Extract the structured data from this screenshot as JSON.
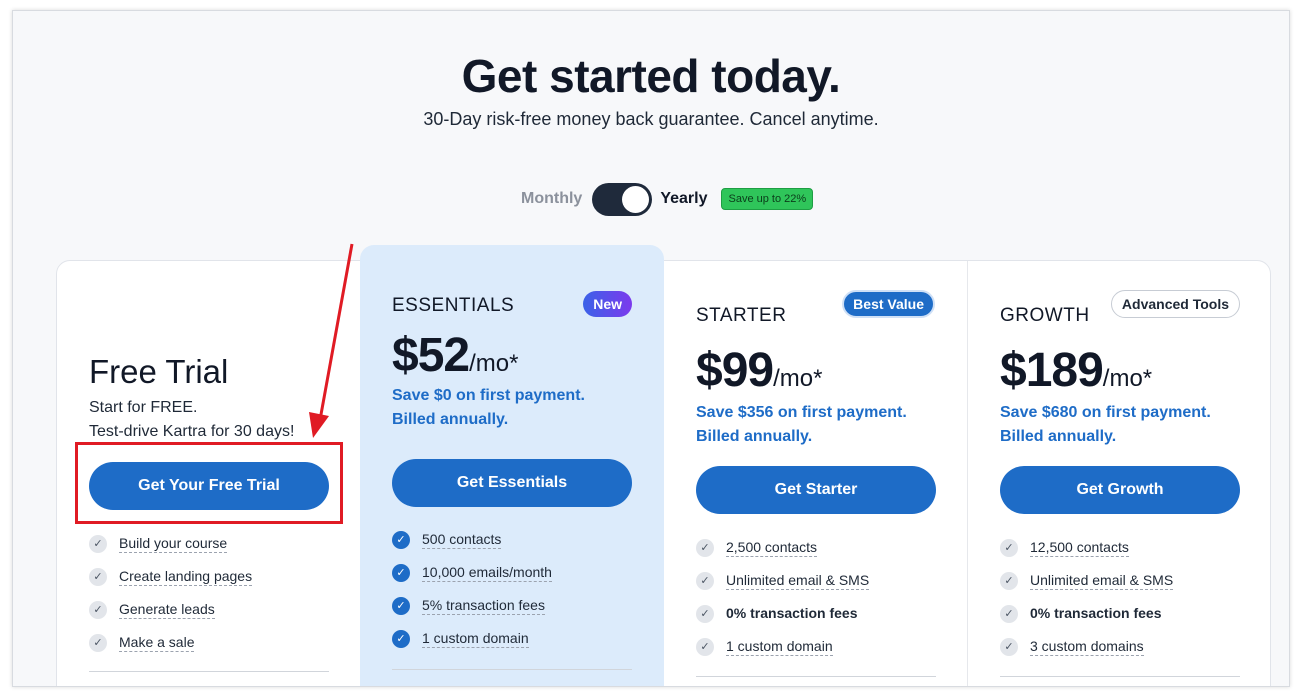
{
  "header": {
    "title": "Get started today.",
    "subtitle": "30-Day risk-free money back guarantee. Cancel anytime."
  },
  "billing_toggle": {
    "monthly_label": "Monthly",
    "yearly_label": "Yearly",
    "selected": "Yearly",
    "save_badge": "Save up to 22%"
  },
  "plans": [
    {
      "title": "Free Trial",
      "subtitle_line1": "Start for FREE.",
      "subtitle_line2": "Test-drive Kartra for 30 days!",
      "cta": "Get Your Free Trial",
      "features": [
        "Build your course",
        "Create landing pages",
        "Generate leads",
        "Make a sale"
      ]
    },
    {
      "name": "ESSENTIALS",
      "badge": "New",
      "price": "$52",
      "per": "/mo*",
      "savings_line1": "Save $0 on first payment.",
      "savings_line2": "Billed annually.",
      "cta": "Get Essentials",
      "features": [
        "500 contacts",
        "10,000 emails/month",
        "5% transaction fees",
        "1 custom domain"
      ]
    },
    {
      "name": "STARTER",
      "badge": "Best Value",
      "price": "$99",
      "per": "/mo*",
      "savings_line1": "Save $356 on first payment.",
      "savings_line2": "Billed annually.",
      "cta": "Get Starter",
      "features": [
        "2,500 contacts",
        "Unlimited email & SMS",
        "0% transaction fees",
        "1 custom domain"
      ]
    },
    {
      "name": "GROWTH",
      "badge": "Advanced Tools",
      "price": "$189",
      "per": "/mo*",
      "savings_line1": "Save $680 on first payment.",
      "savings_line2": "Billed annually.",
      "cta": "Get Growth",
      "features": [
        "12,500 contacts",
        "Unlimited email & SMS",
        "0% transaction fees",
        "3 custom domains"
      ]
    }
  ],
  "colors": {
    "accent": "#1e6cc7",
    "highlight_box": "#e01b24",
    "featured_card_bg": "#dcebfb",
    "save_badge": "#2fc55a"
  },
  "icons": [
    "check-icon",
    "annotation-arrow"
  ]
}
